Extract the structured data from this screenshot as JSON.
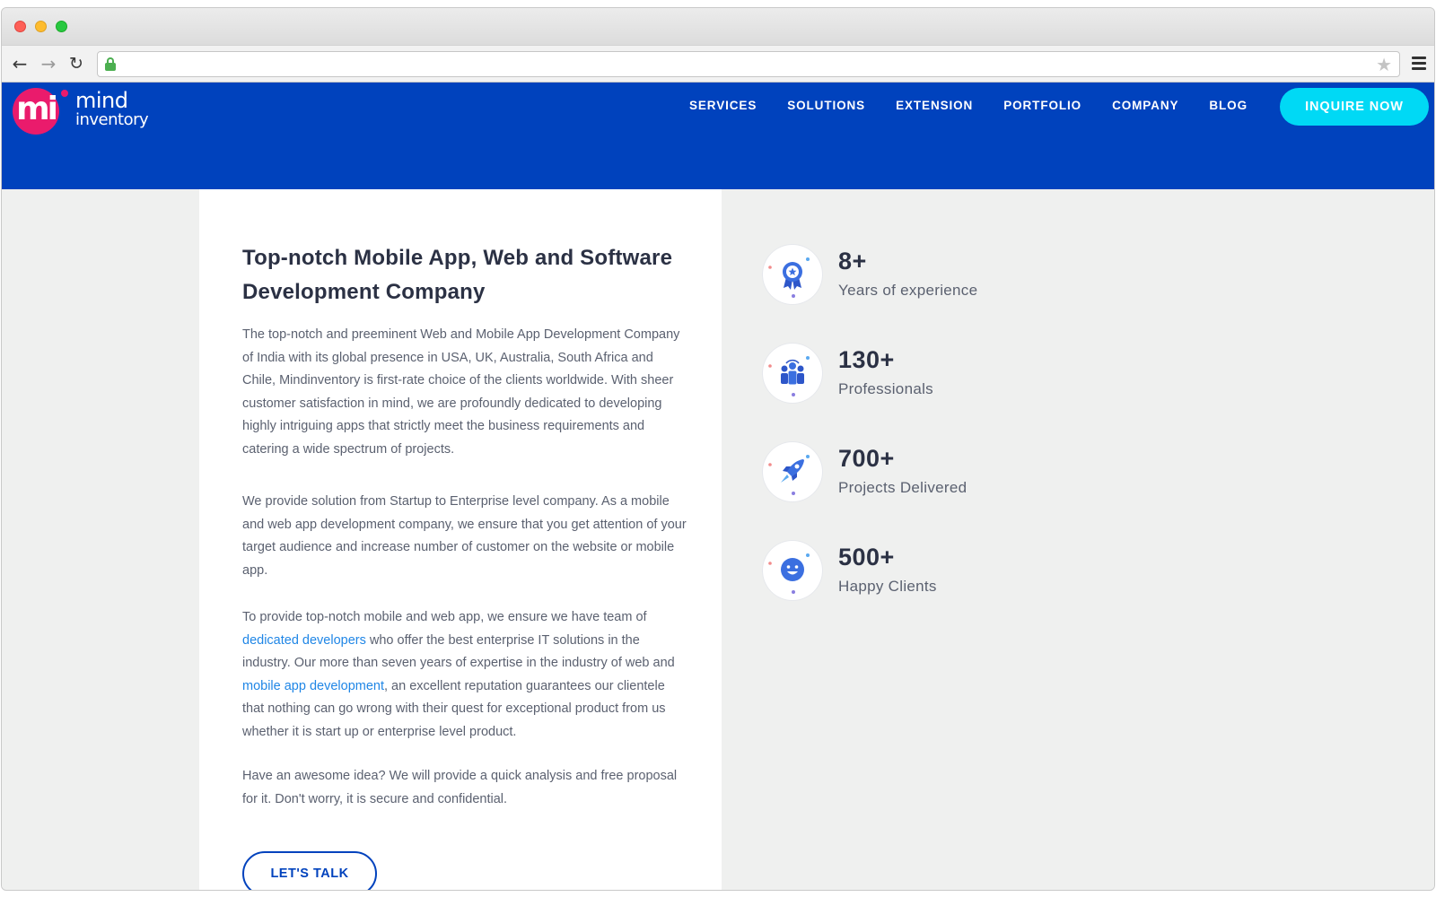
{
  "browser": {
    "traffic_lights": [
      "close",
      "minimize",
      "zoom"
    ],
    "url": ""
  },
  "site": {
    "logo": {
      "mark": "mi",
      "line1": "mind",
      "line2": "inventory"
    },
    "nav": [
      {
        "label": "SERVICES"
      },
      {
        "label": "SOLUTIONS"
      },
      {
        "label": "EXTENSION"
      },
      {
        "label": "PORTFOLIO"
      },
      {
        "label": "COMPANY"
      },
      {
        "label": "BLOG"
      }
    ],
    "cta_label": "INQUIRE NOW"
  },
  "main": {
    "headline": "Top-notch Mobile App, Web and Software Development Company",
    "p1": "The top-notch and preeminent Web and Mobile App Development Company of India with its global presence in USA, UK, Australia, South Africa and Chile, Mindinventory is first-rate choice of the clients worldwide. With sheer customer satisfaction in mind, we are profoundly dedicated to developing highly intriguing apps that strictly meet the business requirements and catering a wide spectrum of projects.",
    "p2": "We provide solution from Startup to Enterprise level company. As a mobile and web app development company, we ensure that you get attention of your target audience and increase number of customer on the website or mobile app.",
    "p3": {
      "part1": "To provide top-notch mobile and web app, we ensure we have team of ",
      "link1": "dedicated developers",
      "part2": " who offer the best enterprise IT solutions in the industry. Our more than seven years of expertise in the industry of web and ",
      "link2": "mobile app development",
      "part3": ", an excellent reputation guarantees our clientele that nothing can go wrong with their quest for exceptional product from us whether it is start up or enterprise level product."
    },
    "p4": "Have an awesome idea? We will provide a quick analysis and free proposal for it. Don't worry, it is secure and confidential.",
    "talk_label": "LET'S TALK"
  },
  "stats": [
    {
      "value": "8+",
      "label": "Years of experience",
      "icon": "award-icon"
    },
    {
      "value": "130+",
      "label": "Professionals",
      "icon": "team-icon"
    },
    {
      "value": "700+",
      "label": "Projects Delivered",
      "icon": "rocket-icon"
    },
    {
      "value": "500+",
      "label": "Happy Clients",
      "icon": "smiley-icon"
    }
  ],
  "colors": {
    "header_blue": "#0042bd",
    "cta_cyan": "#00d9f5",
    "logo_pink": "#ea1b6c",
    "link_blue": "#1f86e6",
    "heading": "#2b3144",
    "body_text": "#5b6170",
    "page_bg": "#eff0ef"
  }
}
